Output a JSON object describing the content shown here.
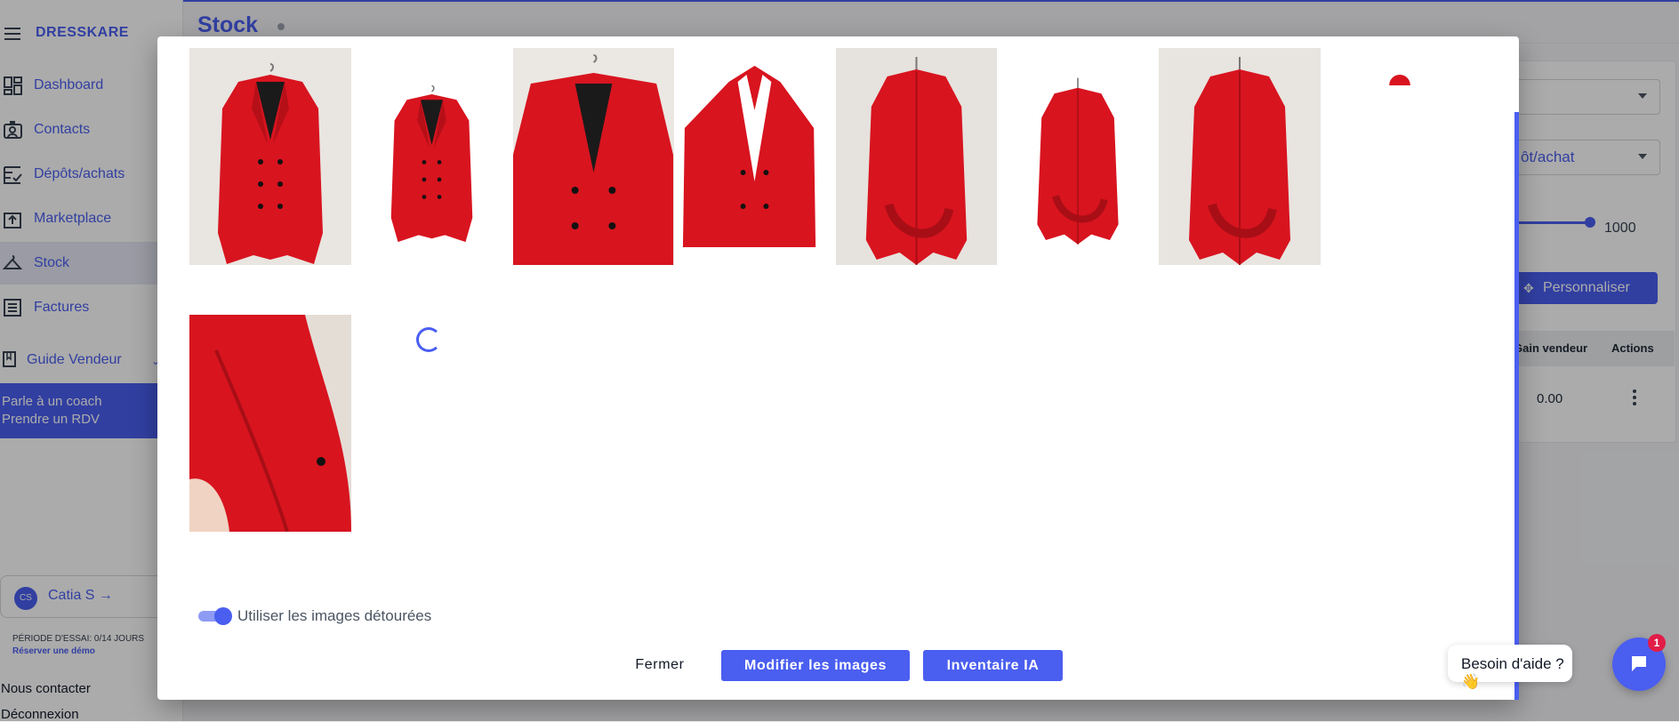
{
  "app": {
    "brand": "DRESSKARE",
    "page_title": "Stock"
  },
  "sidebar": {
    "items": [
      {
        "label": "Dashboard",
        "icon": "dashboard-icon"
      },
      {
        "label": "Contacts",
        "icon": "contacts-icon"
      },
      {
        "label": "Dépôts/achats",
        "icon": "deposits-icon"
      },
      {
        "label": "Marketplace",
        "icon": "marketplace-icon"
      },
      {
        "label": "Stock",
        "icon": "hanger-icon",
        "active": true
      },
      {
        "label": "Factures",
        "icon": "invoice-icon"
      }
    ],
    "guide_label": "Guide Vendeur",
    "coach": {
      "line1": "Parle à un coach",
      "line2": "Prendre un RDV"
    },
    "user": {
      "initials": "CS",
      "name": "Catia S →"
    },
    "trial": {
      "text": "PÉRIODE D'ESSAI: 0/14 JOURS",
      "demo": "Réserver une démo"
    },
    "contact_label": "Nous contacter",
    "logout_label": "Déconnexion"
  },
  "background_panel": {
    "select2_text": "ôt/achat",
    "slider": {
      "value": "1000"
    },
    "customize_label": "Personnaliser",
    "columns": [
      "Gain vendeur",
      "Actions"
    ],
    "row_value": "0.00"
  },
  "modal": {
    "images": [
      {
        "name": "coat-front-hanger",
        "kind": "coat-front",
        "bg": "#e9e5e0"
      },
      {
        "name": "coat-front-cutout",
        "kind": "coat-front-small",
        "bg": "#ffffff"
      },
      {
        "name": "coat-closeup-hanger",
        "kind": "coat-closeup",
        "bg": "#ebe7e2"
      },
      {
        "name": "coat-cutout-collar",
        "kind": "coat-cutout-collar",
        "bg": "#ffffff"
      },
      {
        "name": "coat-back-hanger",
        "kind": "coat-back",
        "bg": "#e6e2dd"
      },
      {
        "name": "coat-back-cutout",
        "kind": "coat-back-small",
        "bg": "#ffffff"
      },
      {
        "name": "coat-back-hanger-2",
        "kind": "coat-back",
        "bg": "#e8e4df"
      },
      {
        "name": "coat-partial-loading",
        "kind": "partial",
        "bg": "#ffffff"
      },
      {
        "name": "coat-detail-hand",
        "kind": "coat-detail",
        "bg": "#e4ddd6"
      }
    ],
    "toggle": {
      "label": "Utiliser les images détourées",
      "on": true
    },
    "buttons": {
      "close": "Fermer",
      "edit_images": "Modifier les images",
      "ai_inventory": "Inventaire IA"
    }
  },
  "help": {
    "text": "Besoin d'aide ? 👋",
    "badge": "1"
  },
  "colors": {
    "accent": "#4a5ef0",
    "coat_red": "#d8141f",
    "badge": "#e11d48"
  }
}
